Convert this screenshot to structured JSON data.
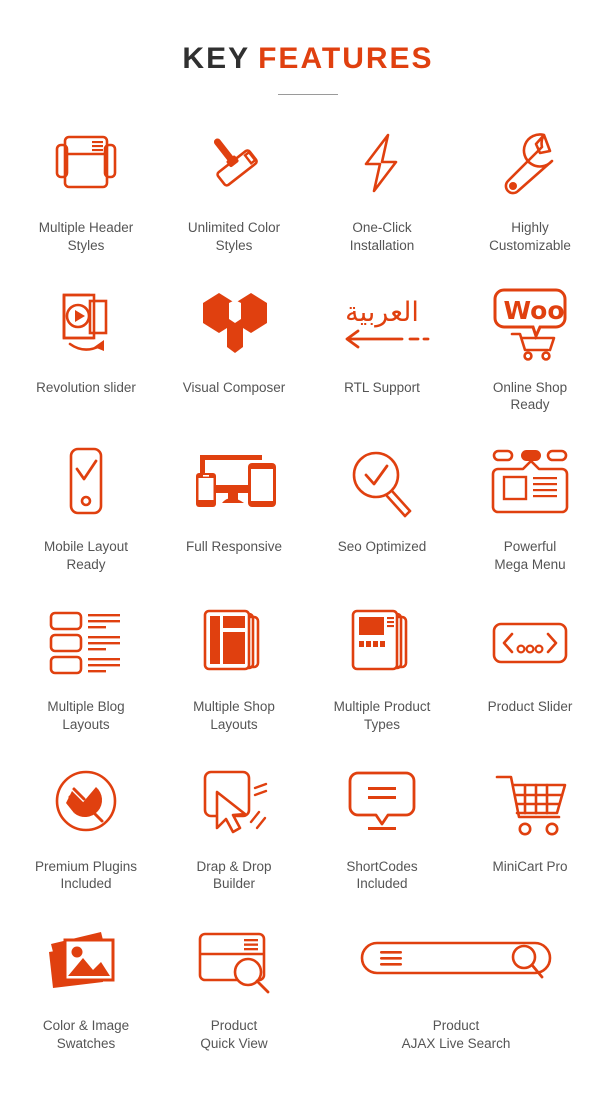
{
  "header": {
    "title_part1": "KEY",
    "title_part2": "FEATURES"
  },
  "colors": {
    "accent": "#e0400f",
    "title_dark": "#303030",
    "label_text": "#555555",
    "divider": "#9a9a9a",
    "background": "#ffffff"
  },
  "features": [
    [
      {
        "icon": "multiple-header-styles-icon",
        "label": "Multiple Header\nStyles"
      },
      {
        "icon": "paint-roller-icon",
        "label": "Unlimited Color\nStyles"
      },
      {
        "icon": "lightning-bolt-icon",
        "label": "One-Click\nInstallation"
      },
      {
        "icon": "wrench-icon",
        "label": "Highly\nCustomizable"
      }
    ],
    [
      {
        "icon": "revolution-slider-icon",
        "label": "Revolution slider"
      },
      {
        "icon": "visual-composer-icon",
        "label": "Visual Composer"
      },
      {
        "icon": "rtl-arabic-icon",
        "label": "RTL Support"
      },
      {
        "icon": "woocommerce-icon",
        "label": "Online Shop\nReady"
      }
    ],
    [
      {
        "icon": "mobile-check-icon",
        "label": "Mobile Layout\nReady"
      },
      {
        "icon": "responsive-devices-icon",
        "label": "Full Responsive"
      },
      {
        "icon": "seo-magnifier-icon",
        "label": "Seo Optimized"
      },
      {
        "icon": "mega-menu-icon",
        "label": "Powerful\nMega Menu"
      }
    ],
    [
      {
        "icon": "blog-list-layout-icon",
        "label": "Multiple Blog\nLayouts"
      },
      {
        "icon": "shop-pages-stack-icon",
        "label": "Multiple Shop\nLayouts"
      },
      {
        "icon": "product-types-icon",
        "label": "Multiple Product\nTypes"
      },
      {
        "icon": "product-slider-icon",
        "label": "Product Slider"
      }
    ],
    [
      {
        "icon": "plugin-plug-icon",
        "label": "Premium Plugins\nIncluded"
      },
      {
        "icon": "drag-drop-cursor-icon",
        "label": "Drap & Drop\nBuilder"
      },
      {
        "icon": "speech-bubble-icon",
        "label": "ShortCodes\nIncluded"
      },
      {
        "icon": "shopping-cart-icon",
        "label": "MiniCart Pro"
      }
    ],
    [
      {
        "icon": "photo-swatches-icon",
        "label": "Color & Image\nSwatches"
      },
      {
        "icon": "quick-view-card-icon",
        "label": "Product\nQuick View"
      },
      {
        "icon": "ajax-live-search-icon",
        "label": "Product\nAJAX Live Search"
      }
    ]
  ],
  "rtl_icon_text": "العربية",
  "woo_icon_text": "Woo"
}
